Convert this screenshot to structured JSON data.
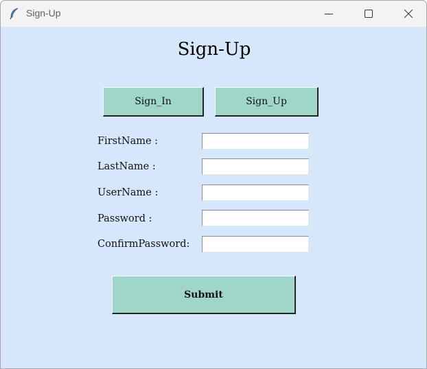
{
  "window": {
    "title": "Sign-Up",
    "icon": "feather-icon",
    "controls": [
      "minimize-icon",
      "maximize-icon",
      "close-icon"
    ]
  },
  "heading": "Sign-Up",
  "nav": {
    "signin_label": "Sign_In",
    "signup_label": "Sign_Up"
  },
  "form": {
    "fields": [
      {
        "label": "FirstName :",
        "value": ""
      },
      {
        "label": "LastName :",
        "value": ""
      },
      {
        "label": "UserName :",
        "value": ""
      },
      {
        "label": "Password :",
        "value": ""
      },
      {
        "label": "ConfirmPassword:",
        "value": ""
      }
    ],
    "submit_label": "Submit"
  },
  "colors": {
    "background": "#d6e7fb",
    "button": "#a0d6c9",
    "titlebar": "#f3f3f3"
  }
}
